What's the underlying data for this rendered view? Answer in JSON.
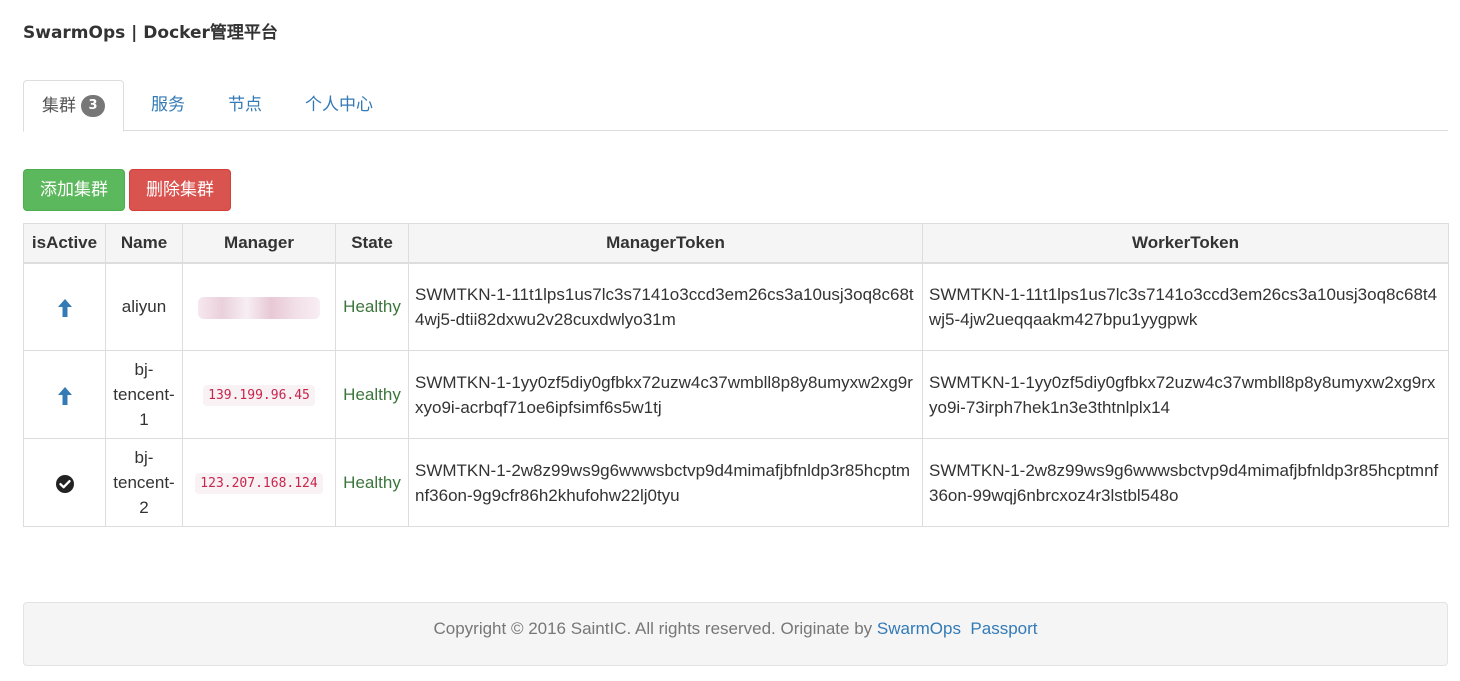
{
  "header": {
    "brand": "SwarmOps | Docker管理平台"
  },
  "tabs": [
    {
      "label": "集群",
      "badge": "3",
      "active": true
    },
    {
      "label": "服务"
    },
    {
      "label": "节点"
    },
    {
      "label": "个人中心"
    }
  ],
  "toolbar": {
    "add_label": "添加集群",
    "delete_label": "删除集群"
  },
  "table": {
    "headers": [
      "isActive",
      "Name",
      "Manager",
      "State",
      "ManagerToken",
      "WorkerToken"
    ],
    "rows": [
      {
        "active_icon": "arrow-up-icon",
        "name": "aliyun",
        "manager": "",
        "state": "Healthy",
        "manager_token": "SWMTKN-1-11t1lps1us7lc3s7141o3ccd3em26cs3a10usj3oq8c68t4wj5-dtii82dxwu2v28cuxdwlyo31m",
        "worker_token": "SWMTKN-1-11t1lps1us7lc3s7141o3ccd3em26cs3a10usj3oq8c68t4wj5-4jw2ueqqaakm427bpu1yygpwk"
      },
      {
        "active_icon": "arrow-up-icon",
        "name": "bj-tencent-1",
        "manager": "139.199.96.45",
        "state": "Healthy",
        "manager_token": "SWMTKN-1-1yy0zf5diy0gfbkx72uzw4c37wmbll8p8y8umyxw2xg9rxyo9i-acrbqf71oe6ipfsimf6s5w1tj",
        "worker_token": "SWMTKN-1-1yy0zf5diy0gfbkx72uzw4c37wmbll8p8y8umyxw2xg9rxyo9i-73irph7hek1n3e3thtnlplx14"
      },
      {
        "active_icon": "check-circle-icon",
        "name": "bj-tencent-2",
        "manager": "123.207.168.124",
        "state": "Healthy",
        "manager_token": "SWMTKN-1-2w8z99ws9g6wwwsbctvp9d4mimafjbfnldp3r85hcptmnf36on-9g9cfr86h2khufohw22lj0tyu",
        "worker_token": "SWMTKN-1-2w8z99ws9g6wwwsbctvp9d4mimafjbfnldp3r85hcptmnf36on-99wqj6nbrcxoz4r3lstbl548o"
      }
    ]
  },
  "footer": {
    "copyright": "Copyright © 2016 SaintIC.  All rights reserved.  Originate by",
    "link1": "SwarmOps",
    "link2": "Passport"
  },
  "colors": {
    "primary": "#337ab7",
    "success": "#5cb85c",
    "danger": "#d9534f",
    "healthy_text": "#3c763d"
  }
}
